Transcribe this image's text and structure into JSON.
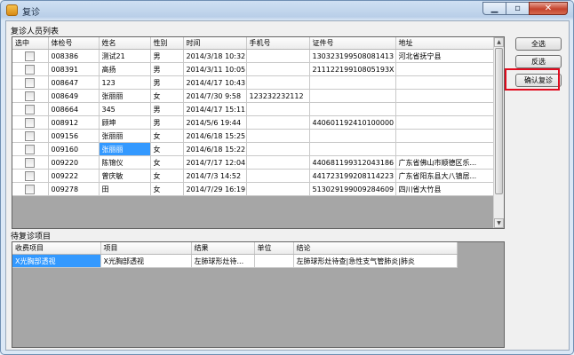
{
  "window": {
    "title": "复诊"
  },
  "patients": {
    "group_label": "复诊人员列表",
    "columns": [
      "选中",
      "体检号",
      "姓名",
      "性别",
      "时间",
      "手机号",
      "证件号",
      "地址"
    ],
    "rows": [
      {
        "checked": false,
        "exam_no": "008386",
        "name": "测试21",
        "sex": "男",
        "time": "2014/3/18 10:32",
        "phone": "",
        "id_no": "130323199508081413",
        "address": "河北省抚宁县"
      },
      {
        "checked": false,
        "exam_no": "008391",
        "name": "高扬",
        "sex": "男",
        "time": "2014/3/11 10:05",
        "phone": "",
        "id_no": "21112219910805193X",
        "address": ""
      },
      {
        "checked": false,
        "exam_no": "008647",
        "name": "123",
        "sex": "男",
        "time": "2014/4/17 10:43",
        "phone": "",
        "id_no": "",
        "address": ""
      },
      {
        "checked": false,
        "exam_no": "008649",
        "name": "张丽丽",
        "sex": "女",
        "time": "2014/7/30 9:58",
        "phone": "123232232112",
        "id_no": "",
        "address": ""
      },
      {
        "checked": false,
        "exam_no": "008664",
        "name": "345",
        "sex": "男",
        "time": "2014/4/17 15:11",
        "phone": "",
        "id_no": "",
        "address": ""
      },
      {
        "checked": false,
        "exam_no": "008912",
        "name": "顾坤",
        "sex": "男",
        "time": "2014/5/6 19:44",
        "phone": "",
        "id_no": "440601192410100000",
        "address": ""
      },
      {
        "checked": false,
        "exam_no": "009156",
        "name": "张丽丽",
        "sex": "女",
        "time": "2014/6/18 15:25",
        "phone": "",
        "id_no": "",
        "address": ""
      },
      {
        "checked": false,
        "exam_no": "009160",
        "name": "张丽丽",
        "sex": "女",
        "time": "2014/6/18 15:22",
        "phone": "",
        "id_no": "",
        "address": ""
      },
      {
        "checked": false,
        "exam_no": "009220",
        "name": "陈锦仪",
        "sex": "女",
        "time": "2014/7/17 12:04",
        "phone": "",
        "id_no": "440681199312043186",
        "address": "广东省佛山市顺德区乐..."
      },
      {
        "checked": false,
        "exam_no": "009222",
        "name": "曾庆敏",
        "sex": "女",
        "time": "2014/7/3 14:52",
        "phone": "",
        "id_no": "441723199208114223",
        "address": "广东省阳东县大八镇居..."
      },
      {
        "checked": false,
        "exam_no": "009278",
        "name": "田",
        "sex": "女",
        "time": "2014/7/29 16:19",
        "phone": "",
        "id_no": "513029199009284609",
        "address": "四川省大竹县"
      }
    ]
  },
  "pending": {
    "group_label": "待复诊项目",
    "columns": [
      "收费项目",
      "项目",
      "结果",
      "单位",
      "结论"
    ],
    "rows": [
      {
        "fee_item": "X光胸部透视",
        "item": "X光胸部透视",
        "result": "左肺球形灶待...",
        "unit": "",
        "conclusion": "左肺球形灶待查|急性支气管肺炎|肺炎"
      }
    ]
  },
  "buttons": {
    "select_all": "全选",
    "invert": "反选",
    "confirm": "确认复诊"
  },
  "icons": {
    "minimize": "minimize-icon",
    "maximize": "maximize-icon",
    "close": "close-icon",
    "app": "app-icon"
  },
  "colors": {
    "selection": "#3399ff",
    "highlight_border": "#e10b1e"
  }
}
